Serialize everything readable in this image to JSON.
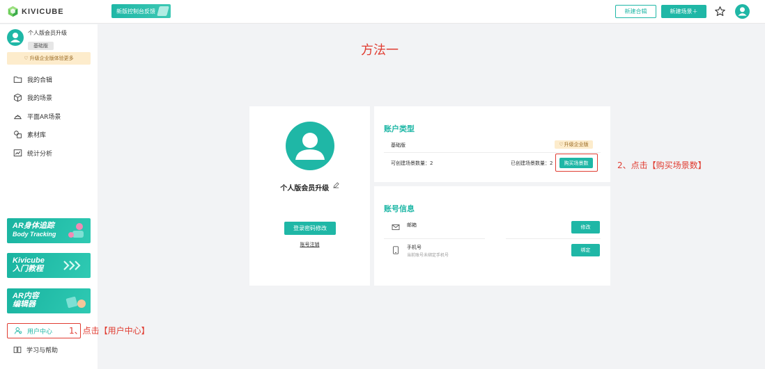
{
  "topbar": {
    "logo_text": "KIVICUBE",
    "feedback_label": "新版控制台反馈",
    "new_collection_label": "新建合辑",
    "new_scene_label": "新建场景＋",
    "colors": {
      "accent": "#1fb7a6",
      "annotation": "#e03c31"
    }
  },
  "sidebar": {
    "user_name": "个人版会员升级",
    "plan": "基础版",
    "upgrade_label": "升级企业版体验更多",
    "nav": [
      {
        "label": "我的合辑",
        "icon": "folder-icon"
      },
      {
        "label": "我的场景",
        "icon": "cube-icon"
      },
      {
        "label": "平面AR场景",
        "icon": "plane-ar-icon"
      },
      {
        "label": "素材库",
        "icon": "library-icon"
      },
      {
        "label": "统计分析",
        "icon": "chart-icon"
      }
    ],
    "banners": [
      {
        "line1": "AR身体追踪",
        "line2": "Body Tracking"
      },
      {
        "line1": "Kivicube",
        "line2": "入门教程"
      },
      {
        "line1": "AR内容",
        "line2": "编辑器"
      }
    ],
    "user_center_label": "用户中心",
    "help_label": "学习与帮助"
  },
  "annotations": {
    "method": "方法一",
    "step1": "1、点击【用户中心】",
    "step2": "2、点击【购买场景数】"
  },
  "profile": {
    "name": "个人版会员升级",
    "change_password_label": "登录密码修改",
    "deregister_label": "账号注销"
  },
  "account_type": {
    "title": "账户类型",
    "plan": "基础版",
    "upgrade_label": "升级企业版",
    "available_label": "可创建场景数量：",
    "available_value": "2",
    "created_label": "已创建场景数量：",
    "created_value": "2",
    "buy_label": "购买场景数"
  },
  "account_info": {
    "title": "账号信息",
    "email_label": "邮箱",
    "email_action": "修改",
    "phone_label": "手机号",
    "phone_hint": "当前账号未绑定手机号",
    "phone_action": "绑定"
  }
}
